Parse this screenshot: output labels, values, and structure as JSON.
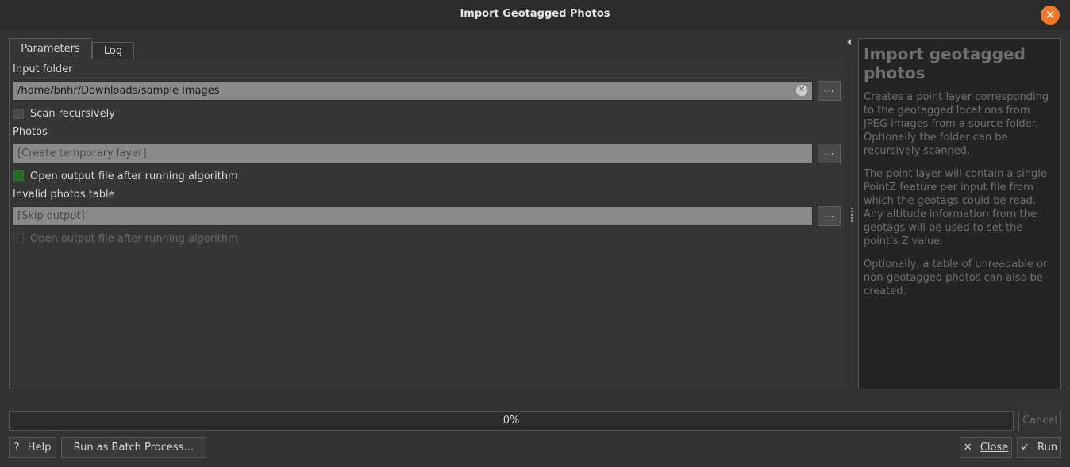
{
  "window": {
    "title": "Import Geotagged Photos"
  },
  "tabs": [
    {
      "label": "Parameters"
    },
    {
      "label": "Log"
    }
  ],
  "params": {
    "input_folder_label": "Input folder",
    "input_folder_value": "/home/bnhr/Downloads/sample images",
    "browse_label": "…",
    "scan_recursively_label": "Scan recursively",
    "photos_label": "Photos",
    "photos_placeholder": "[Create temporary layer]",
    "open_output_label": "Open output file after running algorithm",
    "invalid_table_label": "Invalid photos table",
    "invalid_table_placeholder": "[Skip output]",
    "open_output_disabled_label": "Open output file after running algorithm"
  },
  "help": {
    "title": "Import geotagged photos",
    "p1": "Creates a point layer corresponding to the geotagged locations from JPEG images from a source folder. Optionally the folder can be recursively scanned.",
    "p2": "The point layer will contain a single PointZ feature per input file from which the geotags could be read. Any altitude information from the geotags will be used to set the point's Z value.",
    "p3": "Optionally, a table of unreadable or non-geotagged photos can also be created."
  },
  "progress": {
    "text": "0%",
    "value": 0
  },
  "buttons": {
    "cancel": "Cancel",
    "help": "Help",
    "batch": "Run as Batch Process…",
    "close": "Close",
    "run": "Run"
  },
  "colors": {
    "accent_close": "#f0792e",
    "checkbox_on": "#1f6b1f"
  }
}
